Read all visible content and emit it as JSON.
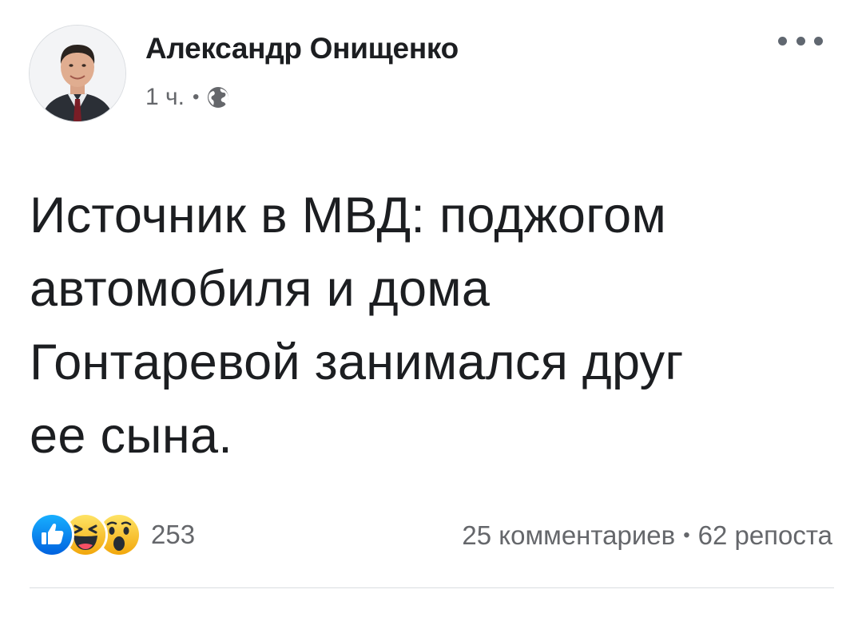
{
  "post": {
    "author": "Александр Онищенко",
    "time": "1 ч.",
    "separator": "•",
    "privacy_icon": "globe-icon",
    "more_icon": "more-horizontal-icon",
    "text_lines": [
      "Источник в МВД: поджогом",
      "автомобиля и дома",
      "Гонтаревой занимался друг",
      "ее сына."
    ]
  },
  "footer": {
    "reactions": [
      "like-icon",
      "haha-icon",
      "wow-icon"
    ],
    "reaction_count": "253",
    "comments": "25 комментариев",
    "separator": "•",
    "shares": "62 репоста"
  },
  "colors": {
    "text_primary": "#1c1e21",
    "text_secondary": "#65676b",
    "like_blue": "#1877f2",
    "emoji_yellow": "#f7b928",
    "divider": "#dadde1"
  }
}
